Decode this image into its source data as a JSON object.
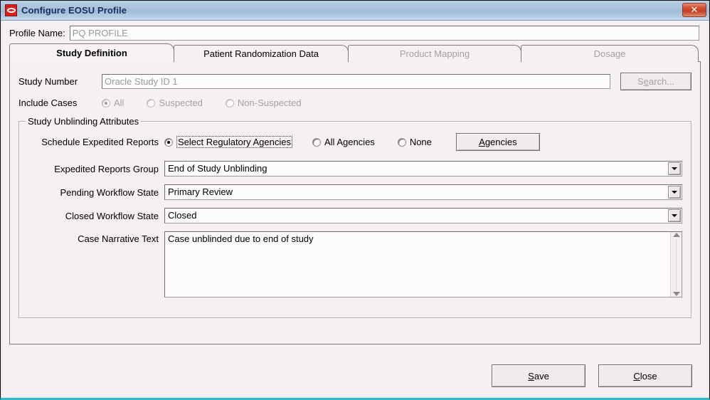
{
  "window": {
    "title": "Configure EOSU Profile",
    "icon": "oracle-logo-icon",
    "close_label": "✕",
    "accent_bottom": "#2fb9c9",
    "titlebar_color": "#a8c2dc"
  },
  "profile": {
    "label": "Profile Name:",
    "value": "PQ PROFILE",
    "placeholder": "PQ PROFILE"
  },
  "tabs": [
    {
      "label": "Study Definition",
      "active": true,
      "disabled": false
    },
    {
      "label": "Patient Randomization Data",
      "active": false,
      "disabled": false
    },
    {
      "label": "Product Mapping",
      "active": false,
      "disabled": true
    },
    {
      "label": "Dosage",
      "active": false,
      "disabled": true
    }
  ],
  "study": {
    "number_label": "Study Number",
    "number_value": "Oracle Study ID 1",
    "search_button": "Search...",
    "search_button_pre": "S",
    "search_button_mnemonic": "e",
    "search_button_post": "arch...",
    "search_disabled": true,
    "include_cases_label": "Include Cases",
    "include_cases_options": [
      {
        "label": "All",
        "checked": true,
        "disabled": true
      },
      {
        "label": "Suspected",
        "checked": false,
        "disabled": true
      },
      {
        "label": "Non-Suspected",
        "checked": false,
        "disabled": true
      }
    ]
  },
  "unblinding": {
    "group_title": "Study Unblinding Attributes",
    "schedule_label": "Schedule Expedited Reports",
    "schedule_options": [
      {
        "label": "Select Regulatory Agencies",
        "checked": true,
        "focused": true
      },
      {
        "label": "All Agencies",
        "checked": false,
        "focused": false
      },
      {
        "label": "None",
        "checked": false,
        "focused": false
      }
    ],
    "agencies_button": "Agencies",
    "agencies_button_mnemonic": "A",
    "agencies_button_post": "gencies",
    "fields": [
      {
        "label": "Expedited Reports Group",
        "value": "End of Study Unblinding"
      },
      {
        "label": "Pending Workflow State",
        "value": "Primary Review"
      },
      {
        "label": "Closed Workflow State",
        "value": "Closed"
      }
    ],
    "narrative_label": "Case Narrative Text",
    "narrative_value": "Case unblinded due to end of study"
  },
  "footer": {
    "save_pre": "",
    "save_mnemonic": "S",
    "save_post": "ave",
    "save_label": "Save",
    "close_mnemonic": "C",
    "close_post": "lose",
    "close_label": "Close"
  }
}
